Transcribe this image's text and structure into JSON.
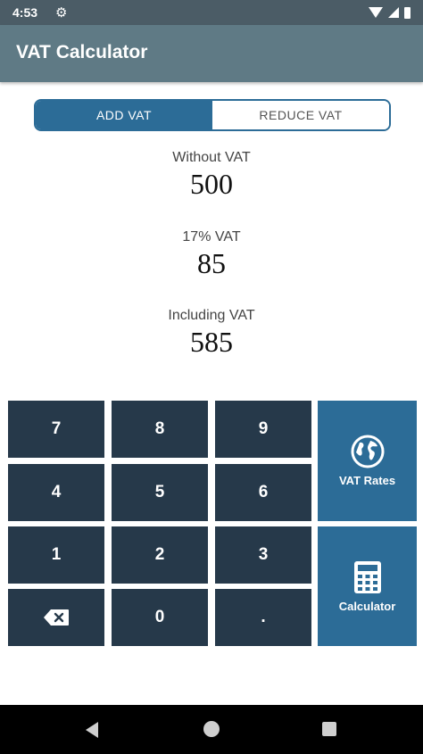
{
  "status_bar": {
    "time": "4:53"
  },
  "app_bar": {
    "title": "VAT Calculator"
  },
  "mode_toggle": {
    "add_label": "ADD VAT",
    "reduce_label": "REDUCE VAT",
    "selected": "ADD VAT"
  },
  "results": {
    "without_vat": {
      "label": "Without VAT",
      "value": "500"
    },
    "vat": {
      "label": "17% VAT",
      "value": "85"
    },
    "including_vat": {
      "label": "Including VAT",
      "value": "585"
    }
  },
  "keypad": {
    "keys": [
      "7",
      "8",
      "9",
      "4",
      "5",
      "6",
      "1",
      "2",
      "3",
      "0",
      "."
    ],
    "backspace_icon": "backspace-icon",
    "vat_rates": {
      "label": "VAT Rates",
      "icon": "globe-icon"
    },
    "calculator": {
      "label": "Calculator",
      "icon": "calculator-icon"
    }
  },
  "colors": {
    "status_bar": "#4b5c66",
    "app_bar": "#5f7a85",
    "accent": "#2c6c97",
    "key": "#26394a",
    "nav_bar": "#000000"
  },
  "nav_bar": {
    "back_icon": "back-icon",
    "home_icon": "home-icon",
    "recents_icon": "recents-icon"
  }
}
